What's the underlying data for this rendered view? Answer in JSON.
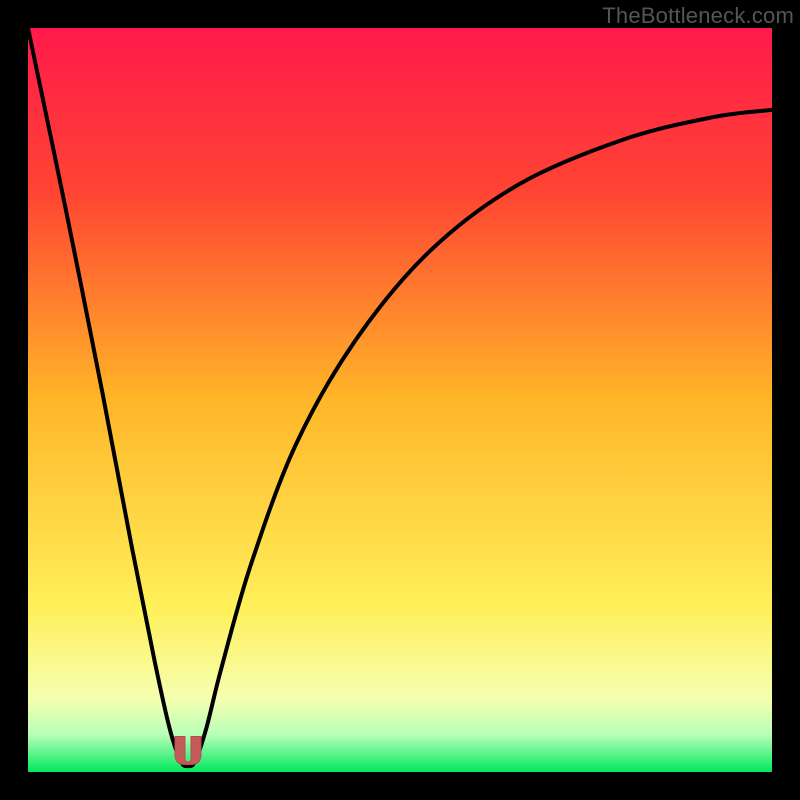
{
  "watermark": "TheBottleneck.com",
  "colors": {
    "frame_border": "#000000",
    "gradient_top": "#ff1a4b",
    "gradient_quarter": "#ff4433",
    "gradient_mid": "#ffb628",
    "gradient_low": "#fff05a",
    "gradient_pale": "#f6ffb0",
    "gradient_green_pale": "#b8ffb8",
    "gradient_green": "#00e85e",
    "curve_stroke": "#000000",
    "marker_fill": "#c55a5a",
    "marker_stroke": "#b84d4d"
  },
  "chart_data": {
    "type": "line",
    "title": "",
    "xlabel": "",
    "ylabel": "",
    "xlim": [
      0,
      100
    ],
    "ylim": [
      0,
      100
    ],
    "note": "Axes are unlabeled; values are relative percentages of the plot extent.",
    "series": [
      {
        "name": "bottleneck-curve",
        "x": [
          0,
          5,
          10,
          14,
          17,
          19,
          20.5,
          21.5,
          22.5,
          24,
          26,
          30,
          36,
          44,
          54,
          66,
          80,
          92,
          100
        ],
        "y": [
          100,
          76,
          51,
          30,
          15,
          6,
          1.5,
          0.8,
          1.5,
          6,
          14,
          28,
          44,
          58,
          70,
          79,
          85,
          88,
          89
        ]
      }
    ],
    "marker": {
      "x": 21.5,
      "y": 1.0,
      "shape": "u",
      "color": "#c55a5a"
    }
  }
}
